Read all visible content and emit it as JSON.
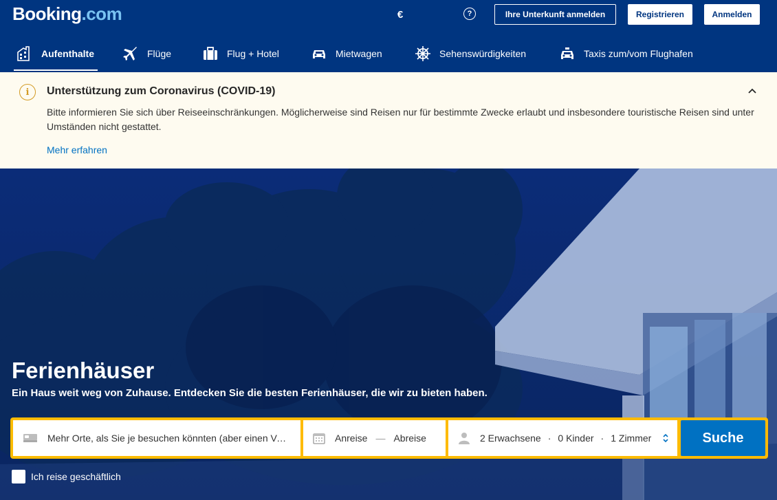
{
  "header": {
    "logo_main": "Booking",
    "logo_suffix": ".com",
    "currency": "€",
    "help": "?",
    "list_property_label": "Ihre Unterkunft anmelden",
    "register_label": "Registrieren",
    "login_label": "Anmelden"
  },
  "nav": {
    "items": [
      {
        "label": "Aufenthalte",
        "icon": "bed-icon",
        "active": true
      },
      {
        "label": "Flüge",
        "icon": "plane-icon"
      },
      {
        "label": "Flug + Hotel",
        "icon": "suitcase-icon"
      },
      {
        "label": "Mietwagen",
        "icon": "car-icon"
      },
      {
        "label": "Sehenswürdigkeiten",
        "icon": "attractions-icon"
      },
      {
        "label": "Taxis zum/vom Flughafen",
        "icon": "taxi-icon"
      }
    ]
  },
  "alert": {
    "title": "Unterstützung zum Coronavirus (COVID-19)",
    "body": "Bitte informieren Sie sich über Reiseeinschränkungen. Möglicherweise sind Reisen nur für bestimmte Zwecke erlaubt und insbesondere touristische Reisen sind unter Umständen nicht gestattet.",
    "link": "Mehr erfahren",
    "icon": "info-icon",
    "accent": "#d39b25"
  },
  "hero": {
    "title": "Ferienhäuser",
    "subtitle": "Ein Haus weit weg von Zuhause. Entdecken Sie die besten Ferienhäuser, die wir zu bieten haben."
  },
  "search": {
    "destination_placeholder": "Mehr Orte, als Sie je besuchen könnten (aber einen Versuch ist es wert)",
    "checkin": "Anreise",
    "checkout": "Abreise",
    "adults": "2 Erwachsene",
    "children": "0 Kinder",
    "rooms": "1 Zimmer",
    "search_label": "Suche",
    "business_label": "Ich reise geschäftlich"
  },
  "colors": {
    "brand_blue": "#003580",
    "search_yellow": "#febb02",
    "button_blue": "#0071c2",
    "alert_bg": "#fefbf0"
  }
}
